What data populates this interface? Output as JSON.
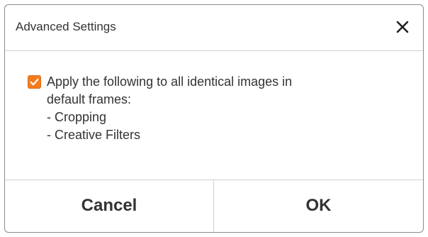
{
  "dialog": {
    "title": "Advanced Settings",
    "close_icon": "close-icon"
  },
  "option": {
    "checked": true,
    "check_color": "#f47c1f",
    "lines": [
      "Apply the following to all identical images in",
      "default frames:",
      "- Cropping",
      "- Creative Filters"
    ]
  },
  "buttons": {
    "cancel": "Cancel",
    "ok": "OK"
  }
}
